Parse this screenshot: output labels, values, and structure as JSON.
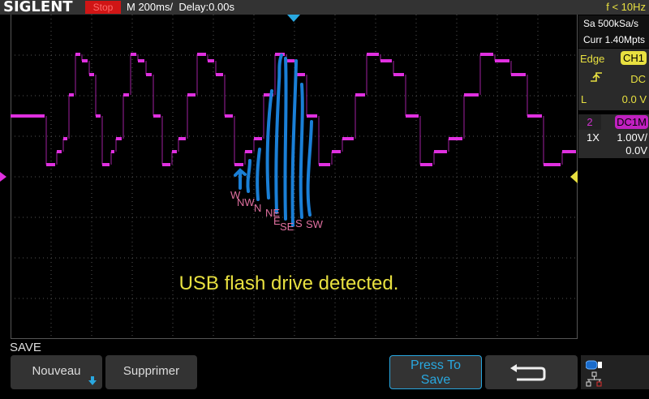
{
  "header": {
    "logo": "SIGLENT",
    "run_state": "Stop",
    "timebase": "M 200ms/",
    "delay": "Delay:0.00s",
    "frequency": "f < 10Hz"
  },
  "acquisition": {
    "sample_rate": "Sa 500kSa/s",
    "memory": "Curr 1.40Mpts"
  },
  "trigger": {
    "type": "Edge",
    "source": "CH1",
    "slope_icon": "rising-edge-icon",
    "coupling": "DC",
    "level_label": "L",
    "level": "0.0 V"
  },
  "channel2": {
    "number": "2",
    "coupling": "DC1M",
    "probe": "1X",
    "scale": "1.00V/",
    "offset": "0.0V"
  },
  "annotations": [
    "W",
    "NW",
    "N",
    "NE",
    "E",
    "SE",
    "S",
    "SW"
  ],
  "message": "USB flash drive detected.",
  "menu": {
    "title": "SAVE",
    "new_label": "Nouveau",
    "delete_label": "Supprimer",
    "save_line1": "Press To",
    "save_line2": "Save",
    "back_icon": "return-arrow-icon",
    "usb_icon": "usb-icon",
    "network_icon": "network-icon"
  },
  "colors": {
    "ch2": "#e030e0",
    "trigger": "#e8e040",
    "annotation_ink": "#1a7fd6",
    "annotation_text": "#e070a0"
  }
}
